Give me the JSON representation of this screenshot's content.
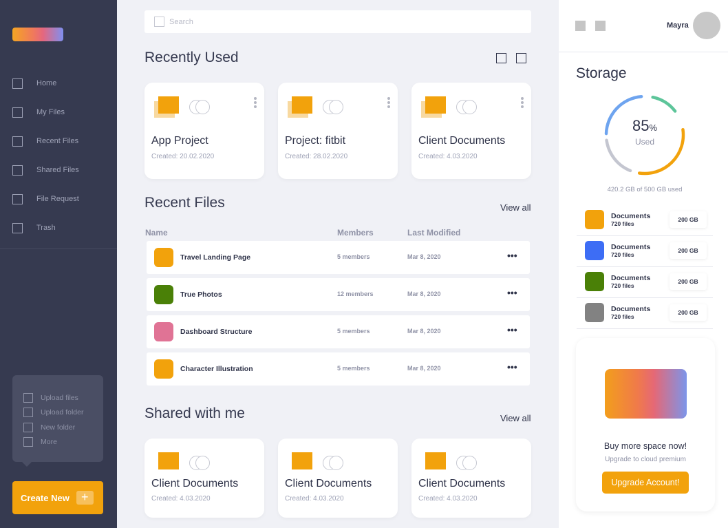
{
  "sidebar": {
    "nav": [
      {
        "label": "Home"
      },
      {
        "label": "My Files"
      },
      {
        "label": "Recent Files"
      },
      {
        "label": "Shared Files"
      },
      {
        "label": "File Request"
      },
      {
        "label": "Trash"
      }
    ],
    "popover": [
      {
        "label": "Upload files"
      },
      {
        "label": "Upload folder"
      },
      {
        "label": "New folder"
      },
      {
        "label": "More"
      }
    ],
    "create_label": "Create New",
    "create_icon": "+"
  },
  "search": {
    "placeholder": "Search",
    "value": ""
  },
  "recently_used": {
    "title": "Recently Used",
    "cards": [
      {
        "title": "App Project",
        "date": "Created: 20.02.2020"
      },
      {
        "title": "Project: fitbit",
        "date": "Created: 28.02.2020"
      },
      {
        "title": "Client Documents",
        "date": "Created: 4.03.2020"
      }
    ]
  },
  "recent_files": {
    "title": "Recent Files",
    "view_all": "View all",
    "columns": [
      "Name",
      "Members",
      "Last Modified"
    ],
    "rows": [
      {
        "name": "Travel Landing Page",
        "members": "5 members",
        "modified": "Mar 8, 2020",
        "color": "#f2a20c"
      },
      {
        "name": "True Photos",
        "members": "12 members",
        "modified": "Mar 8, 2020",
        "color": "#4a8007"
      },
      {
        "name": "Dashboard Structure",
        "members": "5 members",
        "modified": "Mar 8, 2020",
        "color": "#e07395"
      },
      {
        "name": "Character Illustration",
        "members": "5 members",
        "modified": "Mar 8, 2020",
        "color": "#f2a20c"
      }
    ],
    "more_label": "•••"
  },
  "shared": {
    "title": "Shared with me",
    "view_all": "View all",
    "cards": [
      {
        "title": "Client Documents",
        "date": "Created: 4.03.2020"
      },
      {
        "title": "Client Documents",
        "date": "Created: 4.03.2020"
      },
      {
        "title": "Client Documents",
        "date": "Created: 4.03.2020"
      }
    ]
  },
  "user": {
    "name": "Mayra"
  },
  "storage": {
    "title": "Storage",
    "percent": "85",
    "percent_sign": "%",
    "used_label": "Used",
    "usage_text": "420.2 GB of 500 GB used",
    "used_fraction": 0.85,
    "ring_colors": [
      "#f2a20c",
      "#c4c6d0",
      "#6ea4ef",
      "#5dc59a"
    ],
    "items": [
      {
        "name": "Documents",
        "files": "720 files",
        "size": "200 GB",
        "color": "#f2a20c"
      },
      {
        "name": "Documents",
        "files": "720 files",
        "size": "200 GB",
        "color": "#3d6df5"
      },
      {
        "name": "Documents",
        "files": "720 files",
        "size": "200 GB",
        "color": "#4a8007"
      },
      {
        "name": "Documents",
        "files": "720 files",
        "size": "200 GB",
        "color": "#828282"
      }
    ]
  },
  "promo": {
    "title": "Buy more space now!",
    "subtitle": "Upgrade to cloud premium",
    "button": "Upgrade Account!"
  }
}
